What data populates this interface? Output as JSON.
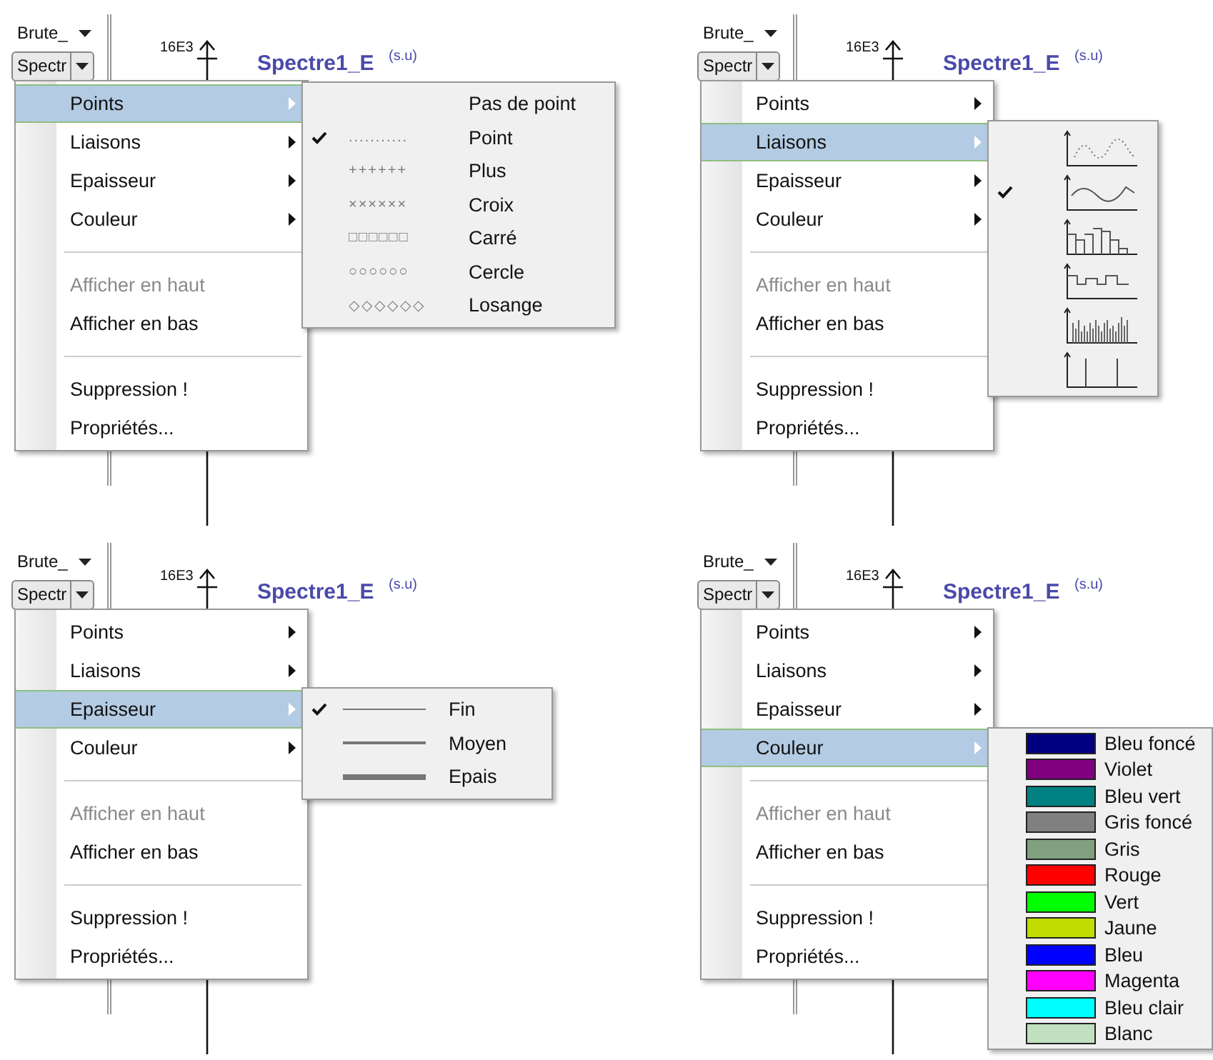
{
  "panels": [
    {
      "toolbar": {
        "dropdown_1": "Brute_",
        "dropdown_2": "Spectr"
      },
      "chart": {
        "axis_label": "16E3",
        "title": "Spectre1_E",
        "unit": "(s.u)"
      },
      "menu": [
        {
          "kind": "item",
          "label": "Points",
          "selected": true,
          "disabled": false,
          "submenu": true
        },
        {
          "kind": "item",
          "label": "Liaisons",
          "selected": false,
          "disabled": false,
          "submenu": true
        },
        {
          "kind": "item",
          "label": "Epaisseur",
          "selected": false,
          "disabled": false,
          "submenu": true
        },
        {
          "kind": "item",
          "label": "Couleur",
          "selected": false,
          "disabled": false,
          "submenu": true
        },
        {
          "kind": "separator"
        },
        {
          "kind": "item",
          "label": "Afficher en haut",
          "selected": false,
          "disabled": true,
          "submenu": false
        },
        {
          "kind": "item",
          "label": "Afficher en bas",
          "selected": false,
          "disabled": false,
          "submenu": false
        },
        {
          "kind": "separator"
        },
        {
          "kind": "item",
          "label": "Suppression !",
          "selected": false,
          "disabled": false,
          "submenu": false
        },
        {
          "kind": "item",
          "label": "Propriétés...",
          "selected": false,
          "disabled": false,
          "submenu": false
        }
      ],
      "submenu": {
        "kind": "points",
        "items": [
          {
            "label": "Pas de point",
            "checked": false
          },
          {
            "label": "Point",
            "sample": "...........",
            "checked": true
          },
          {
            "label": "Plus",
            "sample": "++++++",
            "checked": false
          },
          {
            "label": "Croix",
            "sample": "××××××",
            "checked": false
          },
          {
            "label": "Carré",
            "sample": "□□□□□□",
            "checked": false
          },
          {
            "label": "Cercle",
            "sample": "○○○○○○",
            "checked": false
          },
          {
            "label": "Losange",
            "sample": "◇◇◇◇◇◇",
            "checked": false
          }
        ]
      }
    },
    {
      "toolbar": {
        "dropdown_1": "Brute_",
        "dropdown_2": "Spectr"
      },
      "chart": {
        "axis_label": "16E3",
        "title": "Spectre1_E",
        "unit": "(s.u)"
      },
      "menu": [
        {
          "kind": "item",
          "label": "Points",
          "selected": false,
          "disabled": false,
          "submenu": true
        },
        {
          "kind": "item",
          "label": "Liaisons",
          "selected": true,
          "disabled": false,
          "submenu": true
        },
        {
          "kind": "item",
          "label": "Epaisseur",
          "selected": false,
          "disabled": false,
          "submenu": true
        },
        {
          "kind": "item",
          "label": "Couleur",
          "selected": false,
          "disabled": false,
          "submenu": true
        },
        {
          "kind": "separator"
        },
        {
          "kind": "item",
          "label": "Afficher en haut",
          "selected": false,
          "disabled": true,
          "submenu": false
        },
        {
          "kind": "item",
          "label": "Afficher en bas",
          "selected": false,
          "disabled": false,
          "submenu": false
        },
        {
          "kind": "separator"
        },
        {
          "kind": "item",
          "label": "Suppression !",
          "selected": false,
          "disabled": false,
          "submenu": false
        },
        {
          "kind": "item",
          "label": "Propriétés...",
          "selected": false,
          "disabled": false,
          "submenu": false
        }
      ],
      "submenu": {
        "kind": "liaisons",
        "items": [
          {
            "kind": "dotted_curve",
            "checked": false
          },
          {
            "kind": "curve",
            "checked": true
          },
          {
            "kind": "bars",
            "checked": false
          },
          {
            "kind": "steps",
            "checked": false
          },
          {
            "kind": "histogram",
            "checked": false
          },
          {
            "kind": "impulses",
            "checked": false
          }
        ]
      }
    },
    {
      "toolbar": {
        "dropdown_1": "Brute_",
        "dropdown_2": "Spectr"
      },
      "chart": {
        "axis_label": "16E3",
        "title": "Spectre1_E",
        "unit": "(s.u)"
      },
      "menu": [
        {
          "kind": "item",
          "label": "Points",
          "selected": false,
          "disabled": false,
          "submenu": true
        },
        {
          "kind": "item",
          "label": "Liaisons",
          "selected": false,
          "disabled": false,
          "submenu": true
        },
        {
          "kind": "item",
          "label": "Epaisseur",
          "selected": true,
          "disabled": false,
          "submenu": true
        },
        {
          "kind": "item",
          "label": "Couleur",
          "selected": false,
          "disabled": false,
          "submenu": true
        },
        {
          "kind": "separator"
        },
        {
          "kind": "item",
          "label": "Afficher en haut",
          "selected": false,
          "disabled": true,
          "submenu": false
        },
        {
          "kind": "item",
          "label": "Afficher en bas",
          "selected": false,
          "disabled": false,
          "submenu": false
        },
        {
          "kind": "separator"
        },
        {
          "kind": "item",
          "label": "Suppression !",
          "selected": false,
          "disabled": false,
          "submenu": false
        },
        {
          "kind": "item",
          "label": "Propriétés...",
          "selected": false,
          "disabled": false,
          "submenu": false
        }
      ],
      "submenu": {
        "kind": "epaisseur",
        "items": [
          {
            "label": "Fin",
            "kind": "thin",
            "checked": true
          },
          {
            "label": "Moyen",
            "kind": "medium",
            "checked": false
          },
          {
            "label": "Epais",
            "kind": "thick",
            "checked": false
          }
        ]
      }
    },
    {
      "toolbar": {
        "dropdown_1": "Brute_",
        "dropdown_2": "Spectr"
      },
      "chart": {
        "axis_label": "16E3",
        "title": "Spectre1_E",
        "unit": "(s.u)"
      },
      "menu": [
        {
          "kind": "item",
          "label": "Points",
          "selected": false,
          "disabled": false,
          "submenu": true
        },
        {
          "kind": "item",
          "label": "Liaisons",
          "selected": false,
          "disabled": false,
          "submenu": true
        },
        {
          "kind": "item",
          "label": "Epaisseur",
          "selected": false,
          "disabled": false,
          "submenu": true
        },
        {
          "kind": "item",
          "label": "Couleur",
          "selected": true,
          "disabled": false,
          "submenu": true
        },
        {
          "kind": "separator"
        },
        {
          "kind": "item",
          "label": "Afficher en haut",
          "selected": false,
          "disabled": true,
          "submenu": false
        },
        {
          "kind": "item",
          "label": "Afficher en bas",
          "selected": false,
          "disabled": false,
          "submenu": false
        },
        {
          "kind": "separator"
        },
        {
          "kind": "item",
          "label": "Suppression !",
          "selected": false,
          "disabled": false,
          "submenu": false
        },
        {
          "kind": "item",
          "label": "Propriétés...",
          "selected": false,
          "disabled": false,
          "submenu": false
        }
      ],
      "submenu": {
        "kind": "couleur",
        "items": [
          {
            "label": "Bleu foncé",
            "color": "#000080"
          },
          {
            "label": "Violet",
            "color": "#800080"
          },
          {
            "label": "Bleu vert",
            "color": "#008080"
          },
          {
            "label": "Gris foncé",
            "color": "#808080"
          },
          {
            "label": "Gris",
            "color": "#80a080"
          },
          {
            "label": "Rouge",
            "color": "#ff0000"
          },
          {
            "label": "Vert",
            "color": "#00ff00"
          },
          {
            "label": "Jaune",
            "color": "#c0dc00"
          },
          {
            "label": "Bleu",
            "color": "#0000ff"
          },
          {
            "label": "Magenta",
            "color": "#ff00ff"
          },
          {
            "label": "Bleu clair",
            "color": "#00ffff"
          },
          {
            "label": "Blanc",
            "color": "#c0e0c0"
          }
        ]
      }
    }
  ]
}
